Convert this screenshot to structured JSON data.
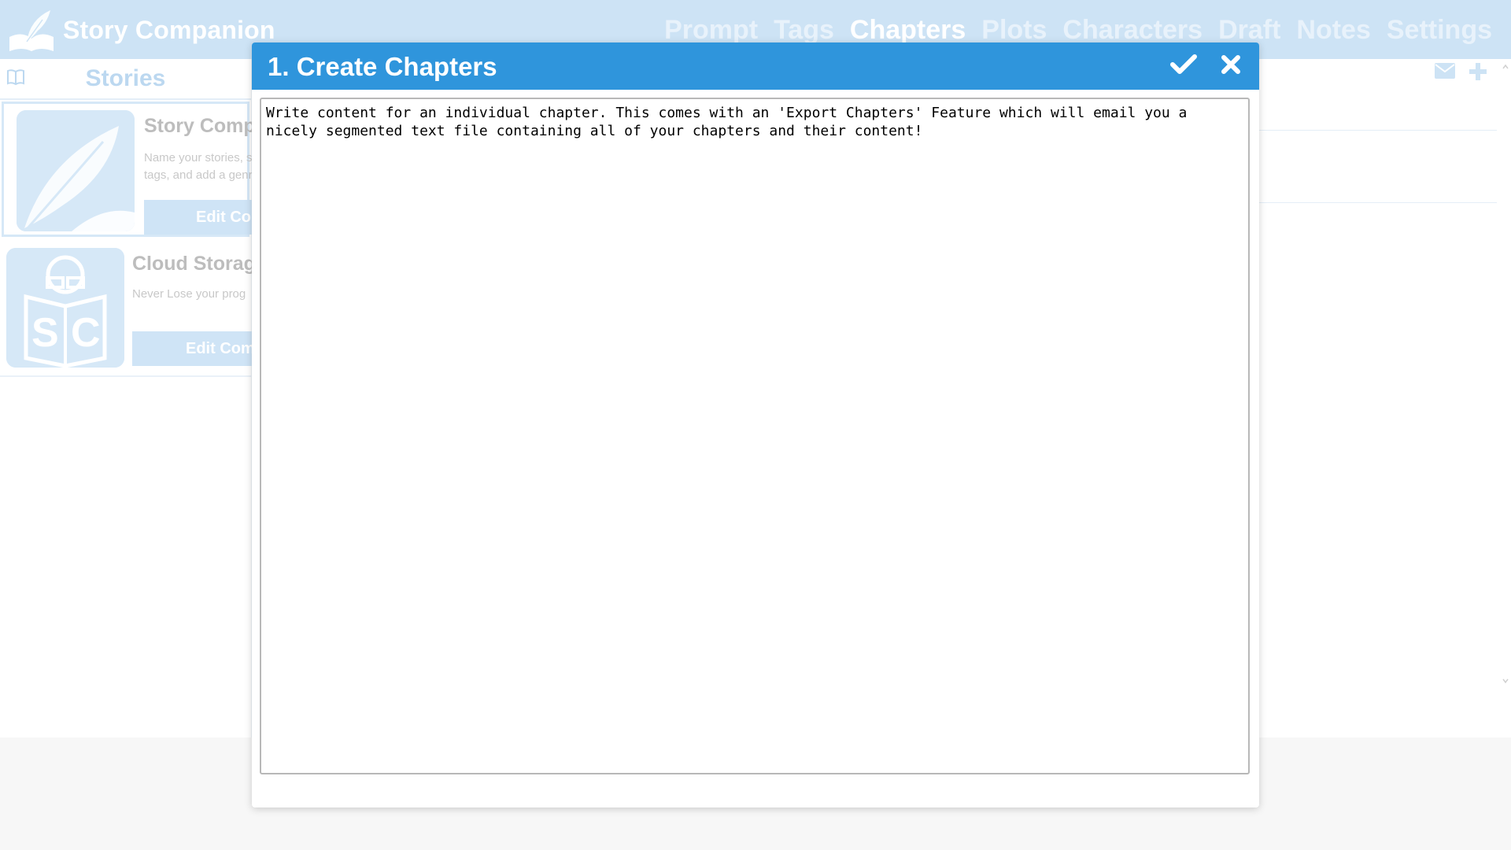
{
  "app": {
    "title": "Story Companion"
  },
  "nav": {
    "items": [
      "Prompt",
      "Tags",
      "Chapters",
      "Plots",
      "Characters",
      "Draft",
      "Notes",
      "Settings"
    ],
    "active": "Chapters"
  },
  "sidebar": {
    "title": "Stories",
    "stories": [
      {
        "name": "Story Compa",
        "desc": "Name your stories, s tags, and add a genr",
        "edit_label": "Edit Con",
        "thumb_icon": "feather-icon"
      },
      {
        "name": "Cloud Storag",
        "desc": "Never Lose your prog",
        "edit_label": "Edit Com",
        "thumb_icon": "reader-sc-icon"
      }
    ]
  },
  "modal": {
    "title": "1. Create Chapters",
    "confirm_icon": "checkmark-icon",
    "close_icon": "close-icon",
    "content": "Write content for an individual chapter. This comes with an 'Export Chapters' Feature which will email you a nicely segmented text file containing all of your chapters and their content!"
  },
  "colors": {
    "header_blue": "#2f95dc",
    "topbar_bg": "#cde3f5",
    "sidebar_accent": "#d6e8f7"
  }
}
